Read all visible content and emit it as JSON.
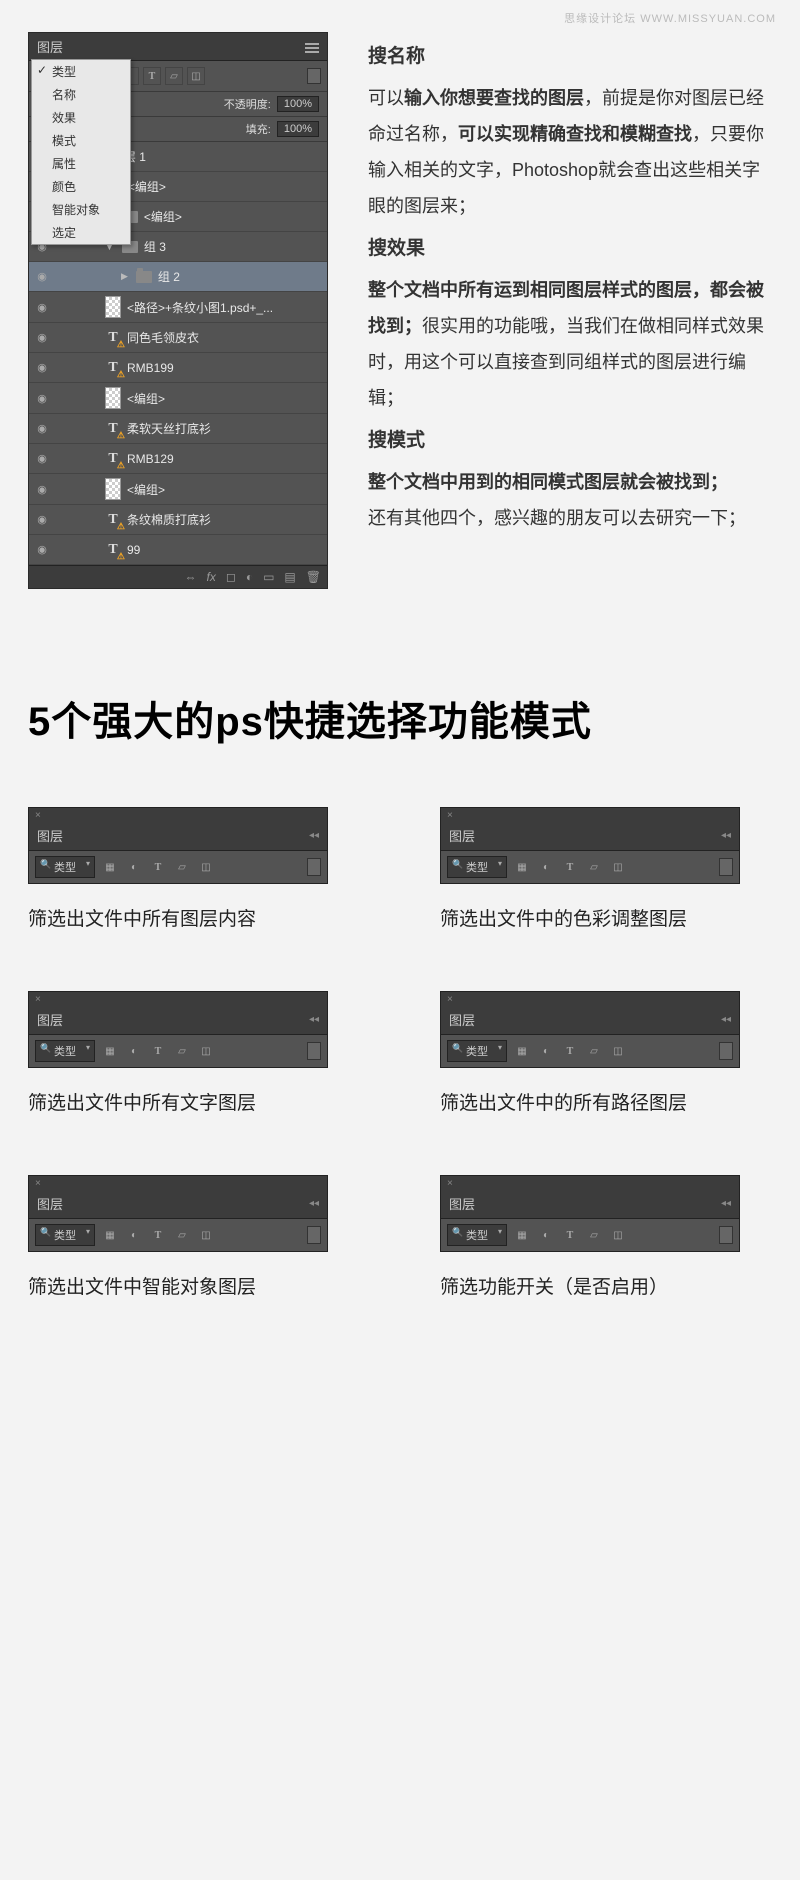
{
  "watermark": "思缘设计论坛  WWW.MISSYUAN.COM",
  "ps_panel": {
    "tab": "图层",
    "filter_value": "类型",
    "opacity_label": "不透明度:",
    "opacity_value": "100%",
    "fill_label": "填充:",
    "fill_value": "100%",
    "menu": [
      "类型",
      "名称",
      "效果",
      "模式",
      "属性",
      "颜色",
      "智能对象",
      "选定"
    ],
    "menu_selected": 0,
    "layers": [
      {
        "type": "group",
        "name": "图层 1",
        "indent": 1,
        "expanded": true
      },
      {
        "type": "group",
        "name": "<编组>",
        "indent": 2,
        "expanded": true
      },
      {
        "type": "group",
        "name": "<编组>",
        "indent": 3,
        "expanded": true
      },
      {
        "type": "group",
        "name": "组 3",
        "indent": 3,
        "expanded": true
      },
      {
        "type": "group",
        "name": "组 2",
        "indent": 4,
        "expanded": false,
        "selected": true
      },
      {
        "type": "bitmap",
        "name": "<路径>+条纹小图1.psd+_...",
        "indent": 3
      },
      {
        "type": "text",
        "name": "同色毛领皮衣",
        "indent": 3
      },
      {
        "type": "text",
        "name": "RMB199",
        "indent": 3
      },
      {
        "type": "bitmap",
        "name": "<编组>",
        "indent": 3
      },
      {
        "type": "text",
        "name": "柔软天丝打底衫",
        "indent": 3
      },
      {
        "type": "text",
        "name": "RMB129",
        "indent": 3
      },
      {
        "type": "bitmap",
        "name": "<编组>",
        "indent": 3
      },
      {
        "type": "text",
        "name": "条纹棉质打底衫",
        "indent": 3
      },
      {
        "type": "text",
        "name": "99",
        "indent": 3
      }
    ]
  },
  "explain": {
    "s1_title": "搜名称",
    "s1_body_a": "可以",
    "s1_body_b": "输入你想要查找的图层",
    "s1_body_c": "，前提是你对图层已经命过名称，",
    "s1_body_d": "可以实现精确查找和模糊查找",
    "s1_body_e": "，只要你输入相关的文字，Photoshop就会查出这些相关字眼的图层来；",
    "s2_title": "搜效果",
    "s2_body_a": "整个文档中所有运到相同图层样式的图层，都会被找到；",
    "s2_body_b": "很实用的功能哦，当我们在做相同样式效果时，用这个可以直接查到同组样式的图层进行编辑；",
    "s3_title": "搜模式",
    "s3_body_a": "整个文档中用到的相同模式图层就会被找到；",
    "s3_body_b": "还有其他四个，感兴趣的朋友可以去研究一下；"
  },
  "big_title": "5个强大的ps快捷选择功能模式",
  "mini_label": "图层",
  "mini_filter": "类型",
  "captions": [
    "筛选出文件中所有图层内容",
    "筛选出文件中的色彩调整图层",
    "筛选出文件中所有文字图层",
    "筛选出文件中的所有路径图层",
    "筛选出文件中智能对象图层",
    "筛选功能开关（是否启用）"
  ],
  "highlights": [
    0,
    1,
    2,
    3,
    4,
    "toggle"
  ]
}
